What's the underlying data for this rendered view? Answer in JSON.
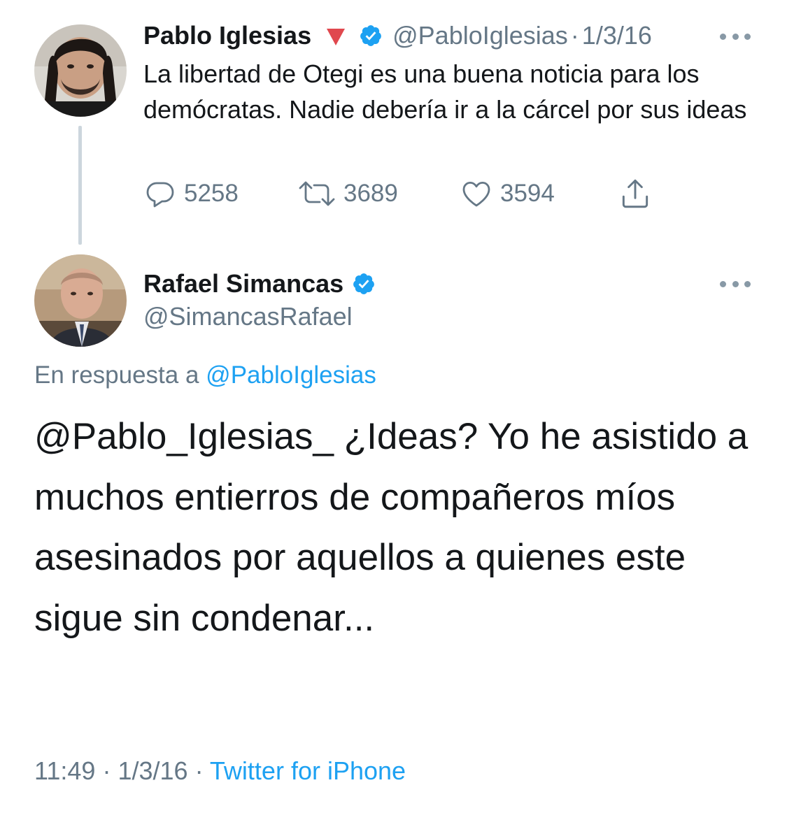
{
  "parent_tweet": {
    "author_name": "Pablo Iglesias",
    "handle": "@PabloIglesias",
    "separator": "·",
    "date": "1/3/16",
    "text": "La libertad de Otegi es una buena noticia para los demócratas. Nadie debería ir a la cárcel por sus ideas",
    "reply_count": "5258",
    "retweet_count": "3689",
    "like_count": "3594",
    "icons": {
      "reply": "reply-icon",
      "retweet": "retweet-icon",
      "like": "heart-icon",
      "share": "share-icon",
      "badge": "verified-icon",
      "flag": "red-triangle-icon",
      "more": "more-icon"
    }
  },
  "reply_tweet": {
    "author_name": "Rafael Simancas",
    "handle": "@SimancasRafael",
    "in_reply_to_label": "En respuesta a",
    "in_reply_to_handle": "@PabloIglesias",
    "text": "@Pablo_Iglesias_ ¿Ideas? Yo he asistido a muchos entierros de compañeros míos asesinados por aquellos a quienes este sigue sin condenar...",
    "time": "11:49",
    "separator": "·",
    "date": "1/3/16",
    "source": "Twitter for iPhone"
  },
  "colors": {
    "accent": "#1da1f2",
    "muted": "#657786",
    "text": "#14171a",
    "thread_line": "#ccd6dd",
    "red_flag": "#e0484e"
  }
}
